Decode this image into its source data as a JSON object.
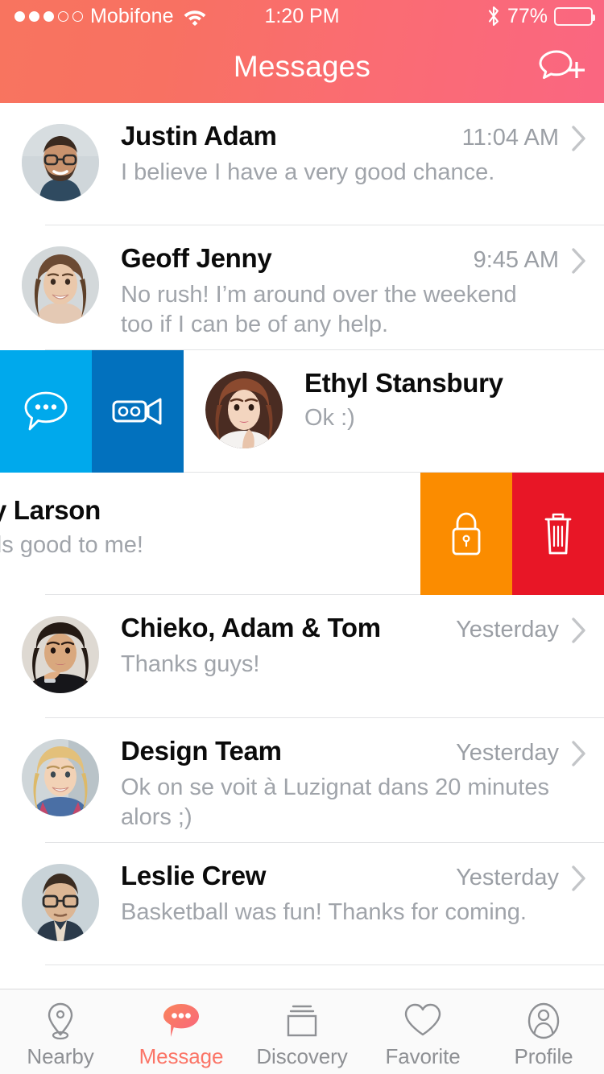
{
  "status_bar": {
    "carrier": "Mobifone",
    "signal_filled": 3,
    "signal_total": 5,
    "wifi": "wifi-icon",
    "time": "1:20 PM",
    "bluetooth": "bluetooth-icon",
    "battery_percent": "77%",
    "battery_level": 77
  },
  "nav": {
    "title": "Messages",
    "compose_icon": "new-message-icon"
  },
  "colors": {
    "header_gradient_start": "#F8745F",
    "header_gradient_end": "#FA6681",
    "accent": "#FB7567",
    "action_chat": "#00A9EC",
    "action_video": "#0271BE",
    "action_lock": "#FB8C00",
    "action_delete": "#E81626",
    "name_text": "#0B0B0B",
    "preview_text": "#A0A4AA",
    "time_text": "#9B9FA5",
    "divider": "#E2E3E5",
    "tab_inactive": "#8E9094"
  },
  "conversations": [
    {
      "name": "Justin Adam",
      "preview": "I believe I have a very good chance.",
      "time": "11:04 AM",
      "avatar": "man-with-glasses-beard",
      "state": "normal"
    },
    {
      "name": "Geoff Jenny",
      "preview": "No rush! I’m around over the weekend too if I can be of any help.",
      "time": "9:45 AM",
      "avatar": "smiling-woman-curly-hair",
      "state": "normal"
    },
    {
      "name": "Ethyl Stansbury",
      "preview": "Ok :)",
      "time": "",
      "avatar": "woman-auburn-hair",
      "state": "swiped-right",
      "left_actions": [
        {
          "label": "",
          "icon": "chat-bubble-icon",
          "color": "#00A9EC",
          "name": "message-action"
        },
        {
          "label": "",
          "icon": "video-camera-icon",
          "color": "#0271BE",
          "name": "video-call-action"
        }
      ]
    },
    {
      "name": "dy Larson",
      "preview": "nds good to me!",
      "time": "",
      "avatar": "hidden",
      "state": "swiped-left",
      "right_actions": [
        {
          "label": "",
          "icon": "lock-icon",
          "color": "#FB8C00",
          "name": "lock-action"
        },
        {
          "label": "",
          "icon": "trash-icon",
          "color": "#E81626",
          "name": "delete-action"
        }
      ]
    },
    {
      "name": "Chieko, Adam & Tom",
      "preview": "Thanks guys!",
      "time": "Yesterday",
      "avatar": "woman-dark-hair-black-top",
      "state": "normal"
    },
    {
      "name": "Design Team",
      "preview": "Ok on se voit à Luzignat dans 20 minutes alors ;)",
      "time": "Yesterday",
      "avatar": "blonde-woman-patterned-blouse",
      "state": "normal"
    },
    {
      "name": "Leslie Crew",
      "preview": "Basketball was fun! Thanks for coming.",
      "time": "Yesterday",
      "avatar": "man-glasses-dark-shirt",
      "state": "normal"
    }
  ],
  "tab_bar": {
    "active_index": 1,
    "tabs": [
      {
        "label": "Nearby",
        "icon": "location-pin-icon"
      },
      {
        "label": "Message",
        "icon": "chat-bubble-filled-icon"
      },
      {
        "label": "Discovery",
        "icon": "stacked-cards-icon"
      },
      {
        "label": "Favorite",
        "icon": "heart-icon"
      },
      {
        "label": "Profile",
        "icon": "person-icon"
      }
    ]
  }
}
